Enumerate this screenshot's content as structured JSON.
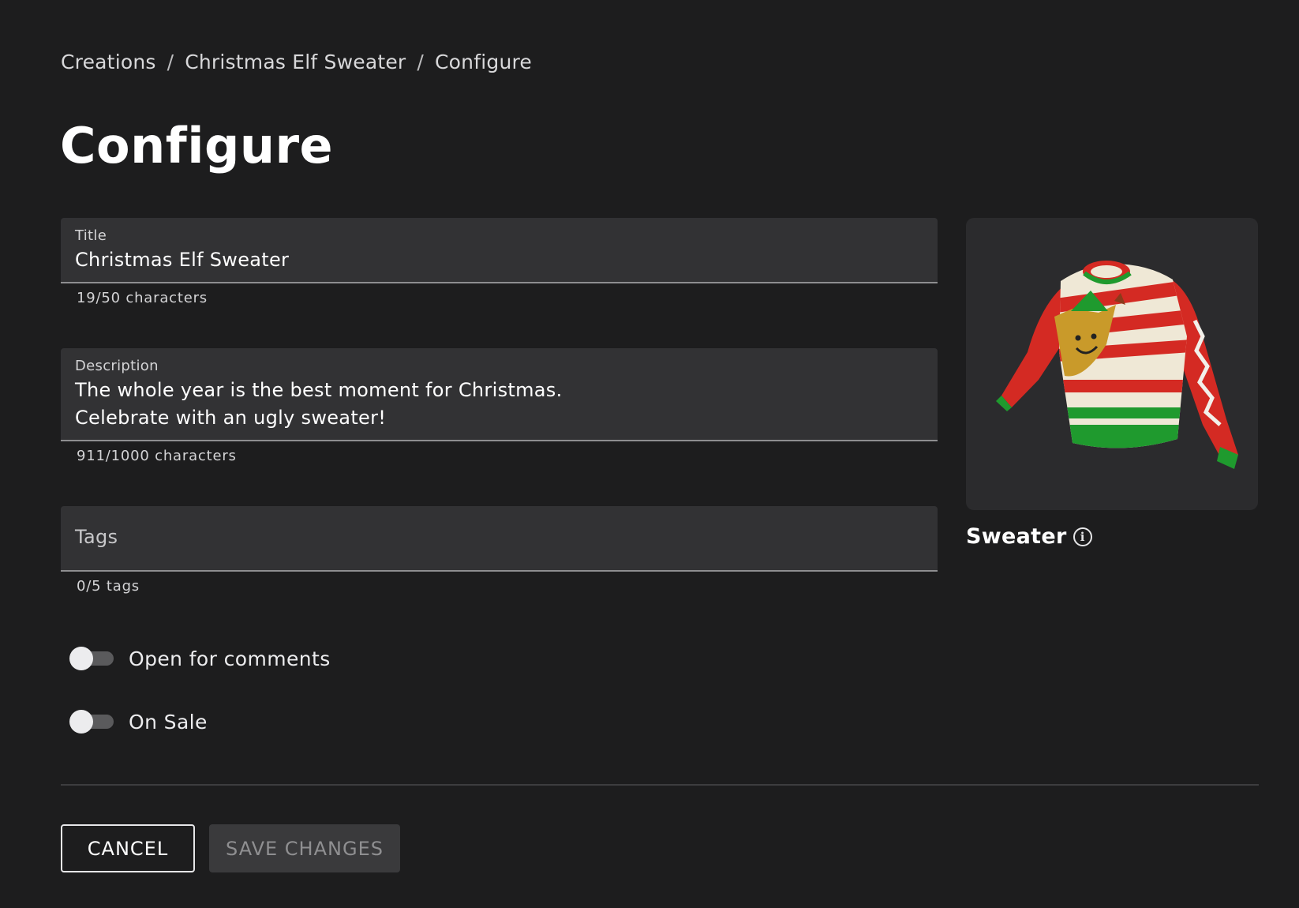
{
  "breadcrumb": {
    "items": [
      "Creations",
      "Christmas Elf Sweater",
      "Configure"
    ],
    "separator": "/"
  },
  "page": {
    "title": "Configure"
  },
  "form": {
    "title": {
      "label": "Title",
      "value": "Christmas Elf Sweater",
      "counter": "19/50 characters"
    },
    "description": {
      "label": "Description",
      "value": "The whole year is the best moment for Christmas.\nCelebrate with an ugly sweater!",
      "counter": "911/1000 characters"
    },
    "tags": {
      "placeholder": "Tags",
      "counter": "0/5 tags"
    },
    "toggles": [
      {
        "label": "Open for comments",
        "on": false
      },
      {
        "label": "On Sale",
        "on": false
      }
    ]
  },
  "preview": {
    "asset_type": "Sweater",
    "info_icon": "info-icon"
  },
  "actions": {
    "cancel_label": "CANCEL",
    "save_label": "SAVE CHANGES"
  },
  "colors": {
    "background": "#1d1d1e",
    "field_bg": "#323234",
    "sweater_red": "#d42a23",
    "sweater_green": "#1f9a2e",
    "sweater_cream": "#efe8d6"
  }
}
